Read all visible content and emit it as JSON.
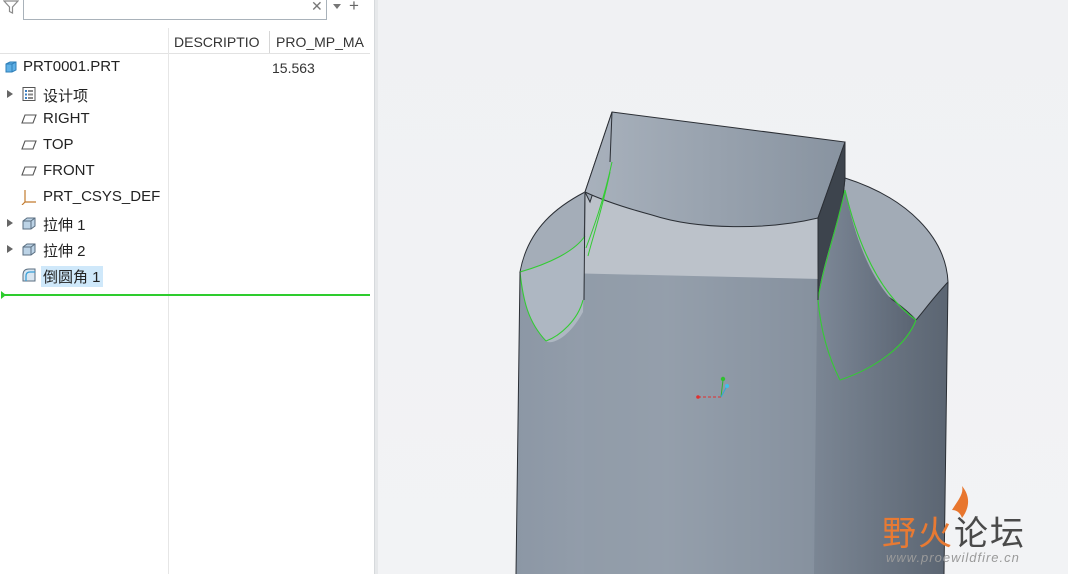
{
  "filter": {
    "value": "",
    "placeholder": ""
  },
  "columns": {
    "description": "DESCRIPTIO",
    "pro_mp_mass": "PRO_MP_MA"
  },
  "tree": {
    "root": {
      "label": "PRT0001.PRT",
      "mp_value": "15.563",
      "icon": "part-icon"
    },
    "items": [
      {
        "label": "设计项",
        "icon": "design-items-icon",
        "expandable": true
      },
      {
        "label": "RIGHT",
        "icon": "datum-plane-icon",
        "expandable": false
      },
      {
        "label": "TOP",
        "icon": "datum-plane-icon",
        "expandable": false
      },
      {
        "label": "FRONT",
        "icon": "datum-plane-icon",
        "expandable": false
      },
      {
        "label": "PRT_CSYS_DEF",
        "icon": "coordinate-system-icon",
        "expandable": false
      },
      {
        "label": "拉伸 1",
        "icon": "extrude-icon",
        "expandable": true
      },
      {
        "label": "拉伸 2",
        "icon": "extrude-icon",
        "expandable": true
      },
      {
        "label": "倒圆角 1",
        "icon": "round-icon",
        "expandable": false,
        "selected": true
      }
    ]
  },
  "watermark": {
    "title_accent": "野火",
    "title_rest": "论坛",
    "url": "www.proewildfire.cn"
  },
  "colors": {
    "selection": "#cfe8fa",
    "insert_line": "#2ecc2e",
    "edge_highlight": "#33cc33",
    "model_body": "#8d98a6",
    "watermark_accent": "#e87a33"
  }
}
